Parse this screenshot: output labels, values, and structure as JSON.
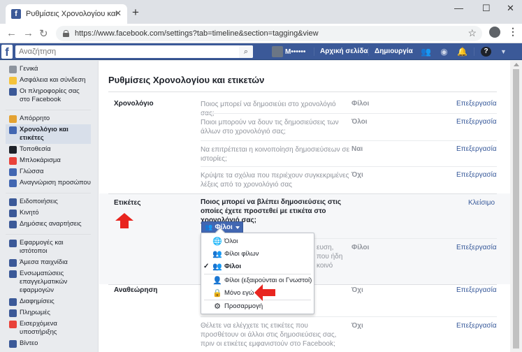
{
  "browser": {
    "tab_title": "Ρυθμίσεις Χρονολογίου και ετικετ...",
    "tab_favicon": "f",
    "url": "https://www.facebook.com/settings?tab=timeline&section=tagging&view"
  },
  "fb_header": {
    "search_placeholder": "Αναζήτηση",
    "user_name": "Μ••••••",
    "home": "Αρχική σελίδα",
    "create": "Δημιουργία"
  },
  "sidebar": {
    "group1": [
      {
        "label": "Γενικά",
        "icon": "gear-icon",
        "color": "#8d949e"
      },
      {
        "label": "Ασφάλεια και σύνδεση",
        "icon": "shield-icon",
        "color": "#f5c33b"
      },
      {
        "label": "Οι πληροφορίες σας στο Facebook",
        "icon": "facebook-icon",
        "color": "#3b5998"
      }
    ],
    "group2": [
      {
        "label": "Απόρρητο",
        "icon": "lock-icon",
        "color": "#e4a232"
      },
      {
        "label": "Χρονολόγιο και ετικέτες",
        "icon": "timeline-icon",
        "color": "#4267b2",
        "active": true
      },
      {
        "label": "Τοποθεσία",
        "icon": "location-icon",
        "color": "#1d2129"
      },
      {
        "label": "Μπλοκάρισμα",
        "icon": "block-icon",
        "color": "#e9423a"
      },
      {
        "label": "Γλώσσα",
        "icon": "language-icon",
        "color": "#4267b2"
      },
      {
        "label": "Αναγνώριση προσώπου",
        "icon": "face-recognition-icon",
        "color": "#4267b2"
      }
    ],
    "group3": [
      {
        "label": "Ειδοποιήσεις",
        "icon": "globe-icon",
        "color": "#3b5998"
      },
      {
        "label": "Κινητό",
        "icon": "mobile-icon",
        "color": "#3b5998"
      },
      {
        "label": "Δημόσιες αναρτήσεις",
        "icon": "rss-icon",
        "color": "#3b5998"
      }
    ],
    "group4": [
      {
        "label": "Εφαρμογές και ιστότοποι",
        "icon": "apps-icon",
        "color": "#3b5998"
      },
      {
        "label": "Άμεσα παιχνίδια",
        "icon": "games-icon",
        "color": "#3b5998"
      },
      {
        "label": "Ενσωματώσεις επαγγελματικών εφαρμογών",
        "icon": "business-integrations-icon",
        "color": "#3b5998"
      },
      {
        "label": "Διαφημίσεις",
        "icon": "ads-icon",
        "color": "#3b5998"
      },
      {
        "label": "Πληρωμές",
        "icon": "payments-icon",
        "color": "#3b5998"
      },
      {
        "label": "Εισερχόμενα υποστήριξης",
        "icon": "support-icon",
        "color": "#e9423a"
      },
      {
        "label": "Βίντεο",
        "icon": "video-icon",
        "color": "#3b5998"
      }
    ]
  },
  "main": {
    "title": "Ρυθμίσεις Χρονολογίου και ετικετών",
    "timeline": {
      "label": "Χρονολόγιο",
      "rows": [
        {
          "q": "Ποιος μπορεί να δημοσιεύει στο χρονολόγιό σας;",
          "v": "Φίλοι",
          "e": "Επεξεργασία"
        },
        {
          "q": "Ποιοι μπορούν να δουν τις δημοσιεύσεις των άλλων στο χρονολόγιό σας;",
          "v": "Όλοι",
          "e": "Επεξεργασία"
        },
        {
          "q": "Να επιτρέπεται η κοινοποίηση δημοσιεύσεων σε ιστορίες;",
          "v": "Ναι",
          "e": "Επεξεργασία"
        },
        {
          "q": "Κρύψτε τα σχόλια που περιέχουν συγκεκριμένες λέξεις από το χρονολόγιό σας",
          "v": "Όχι",
          "e": "Επεξεργασία"
        }
      ]
    },
    "tags": {
      "label": "Ετικέτες",
      "question": "Ποιος μπορεί να βλέπει δημοσιεύσεις στις οποίες έχετε προστεθεί με ετικέτα στο χρονολόγιό σας;",
      "close": "Κλείσιμο",
      "button": "Φίλοι",
      "hidden_row": {
        "q_tail": [
          "ευση,",
          "που ήδη",
          "κοινό"
        ],
        "v": "Φίλοι",
        "e": "Επεξεργασία"
      }
    },
    "review": {
      "label": "Αναθεώρηση",
      "rows": [
        {
          "v": "Όχι",
          "e": "Επεξεργασία"
        },
        {
          "q": "Θέλετε να ελέγχετε τις ετικέτες που προσθέτουν οι άλλοι στις δημοσιεύσεις σας, πριν οι ετικέτες εμφανιστούν στο Facebook;",
          "v": "Όχι",
          "e": "Επεξεργασία"
        }
      ]
    },
    "menu": [
      {
        "label": "Όλοι",
        "icon": "globe-icon"
      },
      {
        "label": "Φίλοι φίλων",
        "icon": "friends-of-friends-icon"
      },
      {
        "label": "Φίλοι",
        "icon": "friends-icon",
        "selected": true
      },
      {
        "label": "Φίλοι (εξαιρούνται οι Γνωστοί)",
        "icon": "friends-except-icon"
      },
      {
        "label": "Μόνο εγώ",
        "icon": "lock-icon"
      },
      {
        "label": "Προσαρμογή",
        "icon": "gear-icon"
      }
    ]
  }
}
